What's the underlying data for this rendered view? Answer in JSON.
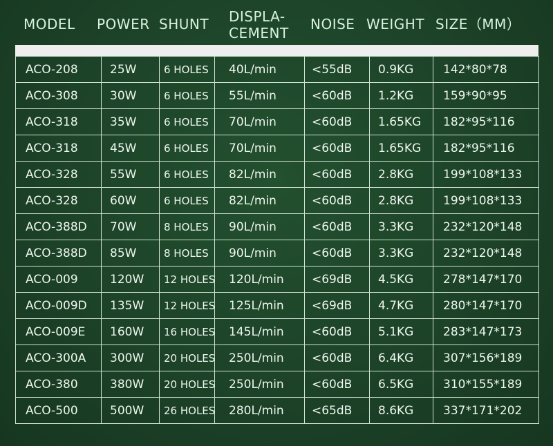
{
  "headers": {
    "model": "MODEL",
    "power": "POWER",
    "shunt": "SHUNT",
    "displacement_line1": "DISPLA-",
    "displacement_line2": "CEMENT",
    "noise": "NOISE",
    "weight": "WEIGHT",
    "size": "SIZE（MM）"
  },
  "rows": [
    {
      "model": "ACO-208",
      "power": "25W",
      "shunt": "6 HOLES",
      "displacement": "40L/min",
      "noise": "<55dB",
      "weight": "0.9KG",
      "size": "142*80*78"
    },
    {
      "model": "ACO-308",
      "power": "30W",
      "shunt": "6 HOLES",
      "displacement": "55L/min",
      "noise": "<60dB",
      "weight": "1.2KG",
      "size": "159*90*95"
    },
    {
      "model": "ACO-318",
      "power": "35W",
      "shunt": "6 HOLES",
      "displacement": "70L/min",
      "noise": "<60dB",
      "weight": "1.65KG",
      "size": "182*95*116"
    },
    {
      "model": "ACO-318",
      "power": "45W",
      "shunt": "6 HOLES",
      "displacement": "70L/min",
      "noise": "<60dB",
      "weight": "1.65KG",
      "size": "182*95*116"
    },
    {
      "model": "ACO-328",
      "power": "55W",
      "shunt": "6 HOLES",
      "displacement": "82L/min",
      "noise": "<60dB",
      "weight": "2.8KG",
      "size": "199*108*133"
    },
    {
      "model": "ACO-328",
      "power": "60W",
      "shunt": "6 HOLES",
      "displacement": "82L/min",
      "noise": "<60dB",
      "weight": "2.8KG",
      "size": "199*108*133"
    },
    {
      "model": "ACO-388D",
      "power": "70W",
      "shunt": "8 HOLES",
      "displacement": "90L/min",
      "noise": "<60dB",
      "weight": "3.3KG",
      "size": "232*120*148"
    },
    {
      "model": "ACO-388D",
      "power": "85W",
      "shunt": "8 HOLES",
      "displacement": "90L/min",
      "noise": "<60dB",
      "weight": "3.3KG",
      "size": "232*120*148"
    },
    {
      "model": "ACO-009",
      "power": "120W",
      "shunt": "12 HOLES",
      "displacement": "120L/min",
      "noise": "<69dB",
      "weight": "4.5KG",
      "size": "278*147*170"
    },
    {
      "model": "ACO-009D",
      "power": "135W",
      "shunt": "12 HOLES",
      "displacement": "125L/min",
      "noise": "<69dB",
      "weight": "4.7KG",
      "size": "280*147*170"
    },
    {
      "model": "ACO-009E",
      "power": "160W",
      "shunt": "16 HOLES",
      "displacement": "145L/min",
      "noise": "<60dB",
      "weight": "5.1KG",
      "size": "283*147*173"
    },
    {
      "model": "ACO-300A",
      "power": "300W",
      "shunt": "20 HOLES",
      "displacement": "250L/min",
      "noise": "<60dB",
      "weight": "6.4KG",
      "size": "307*156*189"
    },
    {
      "model": "ACO-380",
      "power": "380W",
      "shunt": "20 HOLES",
      "displacement": "250L/min",
      "noise": "<60dB",
      "weight": "6.5KG",
      "size": "310*155*189"
    },
    {
      "model": "ACO-500",
      "power": "500W",
      "shunt": "26 HOLES",
      "displacement": "280L/min",
      "noise": "<65dB",
      "weight": "8.6KG",
      "size": "337*171*202"
    }
  ]
}
